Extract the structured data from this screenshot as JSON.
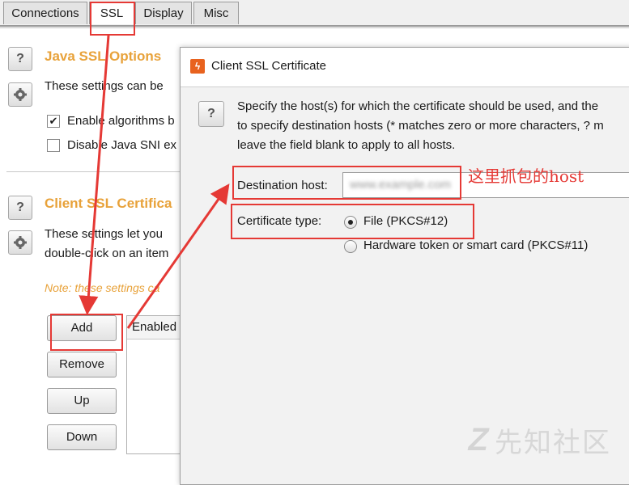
{
  "tabs": [
    {
      "label": "Connections"
    },
    {
      "label": "SSL"
    },
    {
      "label": "Display"
    },
    {
      "label": "Misc"
    }
  ],
  "java_ssl": {
    "title": "Java SSL Options",
    "desc": "These settings can be",
    "options": [
      {
        "label": "Enable algorithms b",
        "checked": true
      },
      {
        "label": "Disable Java SNI ex",
        "checked": false
      }
    ]
  },
  "client_ssl": {
    "title": "Client SSL Certifica",
    "desc_line1": "These settings let you",
    "desc_line2": "double-click on an item",
    "note": "Note: these settings ca",
    "buttons": {
      "add": "Add",
      "remove": "Remove",
      "up": "Up",
      "down": "Down"
    },
    "table_header": "Enabled"
  },
  "dialog": {
    "title": "Client SSL Certificate",
    "desc_line1": "Specify the host(s) for which the certificate should be used, and the",
    "desc_line2": "to specify destination hosts (* matches zero or more characters, ? m",
    "desc_line3": "leave the field blank to apply to all hosts.",
    "destination_label": "Destination host:",
    "destination_value": "www.example.com",
    "cert_type_label": "Certificate type:",
    "cert_options": [
      {
        "label": "File (PKCS#12)",
        "selected": true
      },
      {
        "label": "Hardware token or smart card (PKCS#11)",
        "selected": false
      }
    ]
  },
  "annotation": {
    "text": "这里抓包的host",
    "color": "#e53935"
  },
  "watermark": {
    "text": "先知社区"
  }
}
